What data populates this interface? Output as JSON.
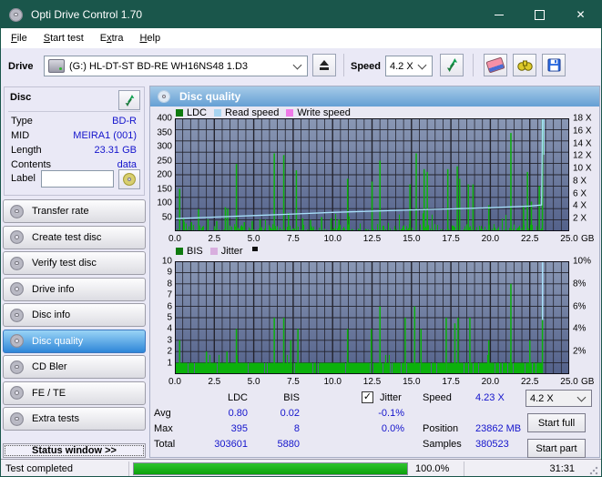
{
  "window": {
    "title": "Opti Drive Control 1.70"
  },
  "menu": {
    "items": [
      {
        "label": "File",
        "accel_index": 0
      },
      {
        "label": "Start test",
        "accel_index": 0
      },
      {
        "label": "Extra",
        "accel_index": 1
      },
      {
        "label": "Help",
        "accel_index": 0
      }
    ]
  },
  "toolbar": {
    "drive_label": "Drive",
    "drive_value": "(G:)  HL-DT-ST BD-RE  WH16NS48 1.D3",
    "speed_label": "Speed",
    "speed_value": "4.2 X",
    "icons": [
      "drive-icon",
      "eject-icon",
      "refresh-icon",
      "eraser-icon",
      "binoculars-icon",
      "save-icon"
    ]
  },
  "sidebar": {
    "disc_panel": {
      "title": "Disc",
      "fields": [
        {
          "label": "Type",
          "value": "BD-R"
        },
        {
          "label": "MID",
          "value": "MEIRA1 (001)"
        },
        {
          "label": "Length",
          "value": "23.31 GB"
        },
        {
          "label": "Contents",
          "value": "data"
        }
      ],
      "label_row": {
        "label": "Label",
        "value": ""
      }
    },
    "nav_buttons": [
      {
        "label": "Transfer rate",
        "active": false
      },
      {
        "label": "Create test disc",
        "active": false
      },
      {
        "label": "Verify test disc",
        "active": false
      },
      {
        "label": "Drive info",
        "active": false
      },
      {
        "label": "Disc info",
        "active": false
      },
      {
        "label": "Disc quality",
        "active": true
      },
      {
        "label": "CD Bler",
        "active": false
      },
      {
        "label": "FE / TE",
        "active": false
      },
      {
        "label": "Extra tests",
        "active": false
      }
    ],
    "status_window_label": "Status window >>"
  },
  "main": {
    "header": "Disc quality",
    "stats": {
      "col_headers": [
        "LDC",
        "BIS"
      ],
      "jitter_checkbox": {
        "label": "Jitter",
        "checked": true
      },
      "rows": [
        {
          "label": "Avg",
          "ldc": "0.80",
          "bis": "0.02",
          "jitter": "-0.1%"
        },
        {
          "label": "Max",
          "ldc": "395",
          "bis": "8",
          "jitter": "0.0%"
        },
        {
          "label": "Total",
          "ldc": "303601",
          "bis": "5880",
          "jitter": ""
        }
      ],
      "info": [
        {
          "label": "Speed",
          "value": "4.23 X"
        },
        {
          "label": "Position",
          "value": "23862 MB"
        },
        {
          "label": "Samples",
          "value": "380523"
        }
      ],
      "speed_select": "4.2 X",
      "start_full": "Start full",
      "start_part": "Start part"
    }
  },
  "statusbar": {
    "status": "Test completed",
    "progress_percent": 100.0,
    "progress_label": "100.0%",
    "time": "31:31"
  },
  "colors": {
    "titlebar": "#1a564b",
    "value_blue": "#1414cc",
    "bar_green": "#0cb10c",
    "read_speed_line": "#a8e0fa",
    "plot_bg_top": "#8a98b5",
    "plot_bg_bottom": "#53618a",
    "grid_line": "#23232d"
  },
  "chart_data": [
    {
      "type": "bar",
      "title": "LDC errors and read speed vs disc position",
      "x_unit": "GB",
      "xlim": [
        0,
        25
      ],
      "x_ticks": [
        0,
        2.5,
        5,
        7.5,
        10,
        12.5,
        15,
        17.5,
        20,
        22.5,
        25
      ],
      "x_tick_labels": [
        "0.0",
        "2.5",
        "5.0",
        "7.5",
        "10.0",
        "12.5",
        "15.0",
        "17.5",
        "20.0",
        "22.5",
        "25.0"
      ],
      "ylim_left": [
        0,
        400
      ],
      "y_ticks_left": [
        400,
        350,
        300,
        250,
        200,
        150,
        100,
        50
      ],
      "ylim_right": [
        0,
        18
      ],
      "y_ticks_right": [
        "18 X",
        "16 X",
        "14 X",
        "12 X",
        "10 X",
        "8 X",
        "6 X",
        "4 X",
        "2 X"
      ],
      "data_end_x": 23.31,
      "grid": true,
      "series": [
        {
          "name": "LDC",
          "type": "bar",
          "color": "#0cb10c",
          "legend_color": "#0f7a0f",
          "spikes": [
            [
              0.3,
              150
            ],
            [
              0.55,
              45
            ],
            [
              1.05,
              32
            ],
            [
              1.5,
              78
            ],
            [
              2.1,
              42
            ],
            [
              2.65,
              36
            ],
            [
              3.2,
              85
            ],
            [
              3.35,
              80
            ],
            [
              3.9,
              238
            ],
            [
              4.4,
              32
            ],
            [
              4.9,
              36
            ],
            [
              5.4,
              42
            ],
            [
              6.3,
              276
            ],
            [
              6.9,
              270
            ],
            [
              7.2,
              65
            ],
            [
              7.7,
              216
            ],
            [
              8.1,
              46
            ],
            [
              8.6,
              40
            ],
            [
              9.3,
              50
            ],
            [
              9.9,
              46
            ],
            [
              10.4,
              42
            ],
            [
              10.95,
              186
            ],
            [
              12.5,
              176
            ],
            [
              13.0,
              250
            ],
            [
              14.9,
              166
            ],
            [
              15.3,
              276
            ],
            [
              15.8,
              220
            ],
            [
              16.0,
              210
            ],
            [
              17.3,
              220
            ],
            [
              17.9,
              230
            ],
            [
              18.05,
              186
            ],
            [
              18.6,
              166
            ],
            [
              18.9,
              166
            ],
            [
              19.9,
              92
            ],
            [
              21.3,
              348
            ],
            [
              22.1,
              92
            ],
            [
              22.35,
              210
            ],
            [
              22.6,
              105
            ],
            [
              23.1,
              160
            ],
            [
              23.3,
              395
            ]
          ],
          "noise": {
            "seed": 42,
            "skip_chance": 0.18,
            "base_max": 24,
            "bump_chance": 0.04,
            "bump_max": 65
          }
        },
        {
          "name": "Read speed",
          "type": "line",
          "color": "#a8e0fa",
          "legend_color": "#a8d4f0",
          "axis": "right",
          "points": [
            [
              0,
              2.0
            ],
            [
              2.5,
              2.25
            ],
            [
              5,
              2.5
            ],
            [
              7.5,
              2.75
            ],
            [
              10,
              3.0
            ],
            [
              12.5,
              3.2
            ],
            [
              15,
              3.4
            ],
            [
              17.5,
              3.55
            ],
            [
              20,
              3.75
            ],
            [
              22.5,
              4.0
            ],
            [
              23.25,
              4.2
            ],
            [
              23.31,
              18
            ],
            [
              23.4,
              18
            ],
            [
              23.4,
              12.2
            ]
          ]
        },
        {
          "name": "Write speed",
          "type": "line",
          "color": "#f080f0",
          "legend_color": "#f07ae8",
          "axis": "right",
          "points": []
        }
      ]
    },
    {
      "type": "bar",
      "title": "BIS errors and jitter vs disc position",
      "x_unit": "GB",
      "xlim": [
        0,
        25
      ],
      "x_ticks": [
        0,
        2.5,
        5,
        7.5,
        10,
        12.5,
        15,
        17.5,
        20,
        22.5,
        25
      ],
      "x_tick_labels": [
        "0.0",
        "2.5",
        "5.0",
        "7.5",
        "10.0",
        "12.5",
        "15.0",
        "17.5",
        "20.0",
        "22.5",
        "25.0"
      ],
      "ylim_left": [
        0,
        10
      ],
      "y_ticks_left": [
        10,
        9,
        8,
        7,
        6,
        5,
        4,
        3,
        2,
        1
      ],
      "ylim_right_percent": [
        0,
        10
      ],
      "y_ticks_right": [
        "10%",
        "8%",
        "6%",
        "4%",
        "2%"
      ],
      "y_ticks_right_values": [
        10,
        8,
        6,
        4,
        2
      ],
      "data_end_x": 23.31,
      "grid": true,
      "series": [
        {
          "name": "BIS",
          "type": "bar",
          "color": "#0cb10c",
          "legend_color": "#0f7a0f",
          "baseline": 1,
          "spikes": [
            [
              0.3,
              3
            ],
            [
              2.0,
              2
            ],
            [
              3.3,
              2
            ],
            [
              3.9,
              4
            ],
            [
              6.3,
              5
            ],
            [
              6.9,
              5
            ],
            [
              7.35,
              3
            ],
            [
              7.8,
              4
            ],
            [
              10.95,
              4
            ],
            [
              12.45,
              4
            ],
            [
              13.0,
              6
            ],
            [
              14.6,
              5
            ],
            [
              15.2,
              6
            ],
            [
              15.6,
              4
            ],
            [
              17.2,
              5
            ],
            [
              17.75,
              4.5
            ],
            [
              17.95,
              5
            ],
            [
              18.7,
              5
            ],
            [
              19.9,
              3
            ],
            [
              21.3,
              8
            ],
            [
              22.5,
              3
            ],
            [
              23.3,
              6
            ]
          ],
          "noise": {
            "seed": 7,
            "gap_chance": 0.1,
            "double_chance": 0.02
          }
        },
        {
          "name": "Jitter",
          "type": "line",
          "color": "#d8aede",
          "legend_color": "#d8aede",
          "points": []
        },
        {
          "name": "end-marker",
          "type": "vline",
          "color": "#a8e0fa",
          "x": 23.31,
          "from": 10,
          "to": 4.8
        }
      ]
    }
  ]
}
